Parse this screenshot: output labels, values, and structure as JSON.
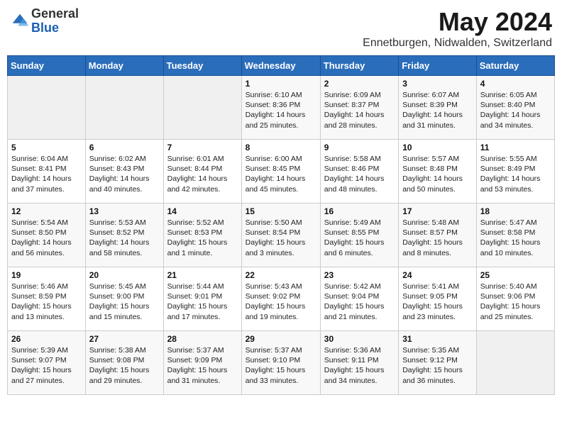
{
  "header": {
    "logo_general": "General",
    "logo_blue": "Blue",
    "month_title": "May 2024",
    "subtitle": "Ennetburgen, Nidwalden, Switzerland"
  },
  "days_of_week": [
    "Sunday",
    "Monday",
    "Tuesday",
    "Wednesday",
    "Thursday",
    "Friday",
    "Saturday"
  ],
  "weeks": [
    [
      {
        "day": "",
        "info": ""
      },
      {
        "day": "",
        "info": ""
      },
      {
        "day": "",
        "info": ""
      },
      {
        "day": "1",
        "info": "Sunrise: 6:10 AM\nSunset: 8:36 PM\nDaylight: 14 hours\nand 25 minutes."
      },
      {
        "day": "2",
        "info": "Sunrise: 6:09 AM\nSunset: 8:37 PM\nDaylight: 14 hours\nand 28 minutes."
      },
      {
        "day": "3",
        "info": "Sunrise: 6:07 AM\nSunset: 8:39 PM\nDaylight: 14 hours\nand 31 minutes."
      },
      {
        "day": "4",
        "info": "Sunrise: 6:05 AM\nSunset: 8:40 PM\nDaylight: 14 hours\nand 34 minutes."
      }
    ],
    [
      {
        "day": "5",
        "info": "Sunrise: 6:04 AM\nSunset: 8:41 PM\nDaylight: 14 hours\nand 37 minutes."
      },
      {
        "day": "6",
        "info": "Sunrise: 6:02 AM\nSunset: 8:43 PM\nDaylight: 14 hours\nand 40 minutes."
      },
      {
        "day": "7",
        "info": "Sunrise: 6:01 AM\nSunset: 8:44 PM\nDaylight: 14 hours\nand 42 minutes."
      },
      {
        "day": "8",
        "info": "Sunrise: 6:00 AM\nSunset: 8:45 PM\nDaylight: 14 hours\nand 45 minutes."
      },
      {
        "day": "9",
        "info": "Sunrise: 5:58 AM\nSunset: 8:46 PM\nDaylight: 14 hours\nand 48 minutes."
      },
      {
        "day": "10",
        "info": "Sunrise: 5:57 AM\nSunset: 8:48 PM\nDaylight: 14 hours\nand 50 minutes."
      },
      {
        "day": "11",
        "info": "Sunrise: 5:55 AM\nSunset: 8:49 PM\nDaylight: 14 hours\nand 53 minutes."
      }
    ],
    [
      {
        "day": "12",
        "info": "Sunrise: 5:54 AM\nSunset: 8:50 PM\nDaylight: 14 hours\nand 56 minutes."
      },
      {
        "day": "13",
        "info": "Sunrise: 5:53 AM\nSunset: 8:52 PM\nDaylight: 14 hours\nand 58 minutes."
      },
      {
        "day": "14",
        "info": "Sunrise: 5:52 AM\nSunset: 8:53 PM\nDaylight: 15 hours\nand 1 minute."
      },
      {
        "day": "15",
        "info": "Sunrise: 5:50 AM\nSunset: 8:54 PM\nDaylight: 15 hours\nand 3 minutes."
      },
      {
        "day": "16",
        "info": "Sunrise: 5:49 AM\nSunset: 8:55 PM\nDaylight: 15 hours\nand 6 minutes."
      },
      {
        "day": "17",
        "info": "Sunrise: 5:48 AM\nSunset: 8:57 PM\nDaylight: 15 hours\nand 8 minutes."
      },
      {
        "day": "18",
        "info": "Sunrise: 5:47 AM\nSunset: 8:58 PM\nDaylight: 15 hours\nand 10 minutes."
      }
    ],
    [
      {
        "day": "19",
        "info": "Sunrise: 5:46 AM\nSunset: 8:59 PM\nDaylight: 15 hours\nand 13 minutes."
      },
      {
        "day": "20",
        "info": "Sunrise: 5:45 AM\nSunset: 9:00 PM\nDaylight: 15 hours\nand 15 minutes."
      },
      {
        "day": "21",
        "info": "Sunrise: 5:44 AM\nSunset: 9:01 PM\nDaylight: 15 hours\nand 17 minutes."
      },
      {
        "day": "22",
        "info": "Sunrise: 5:43 AM\nSunset: 9:02 PM\nDaylight: 15 hours\nand 19 minutes."
      },
      {
        "day": "23",
        "info": "Sunrise: 5:42 AM\nSunset: 9:04 PM\nDaylight: 15 hours\nand 21 minutes."
      },
      {
        "day": "24",
        "info": "Sunrise: 5:41 AM\nSunset: 9:05 PM\nDaylight: 15 hours\nand 23 minutes."
      },
      {
        "day": "25",
        "info": "Sunrise: 5:40 AM\nSunset: 9:06 PM\nDaylight: 15 hours\nand 25 minutes."
      }
    ],
    [
      {
        "day": "26",
        "info": "Sunrise: 5:39 AM\nSunset: 9:07 PM\nDaylight: 15 hours\nand 27 minutes."
      },
      {
        "day": "27",
        "info": "Sunrise: 5:38 AM\nSunset: 9:08 PM\nDaylight: 15 hours\nand 29 minutes."
      },
      {
        "day": "28",
        "info": "Sunrise: 5:37 AM\nSunset: 9:09 PM\nDaylight: 15 hours\nand 31 minutes."
      },
      {
        "day": "29",
        "info": "Sunrise: 5:37 AM\nSunset: 9:10 PM\nDaylight: 15 hours\nand 33 minutes."
      },
      {
        "day": "30",
        "info": "Sunrise: 5:36 AM\nSunset: 9:11 PM\nDaylight: 15 hours\nand 34 minutes."
      },
      {
        "day": "31",
        "info": "Sunrise: 5:35 AM\nSunset: 9:12 PM\nDaylight: 15 hours\nand 36 minutes."
      },
      {
        "day": "",
        "info": ""
      }
    ]
  ]
}
